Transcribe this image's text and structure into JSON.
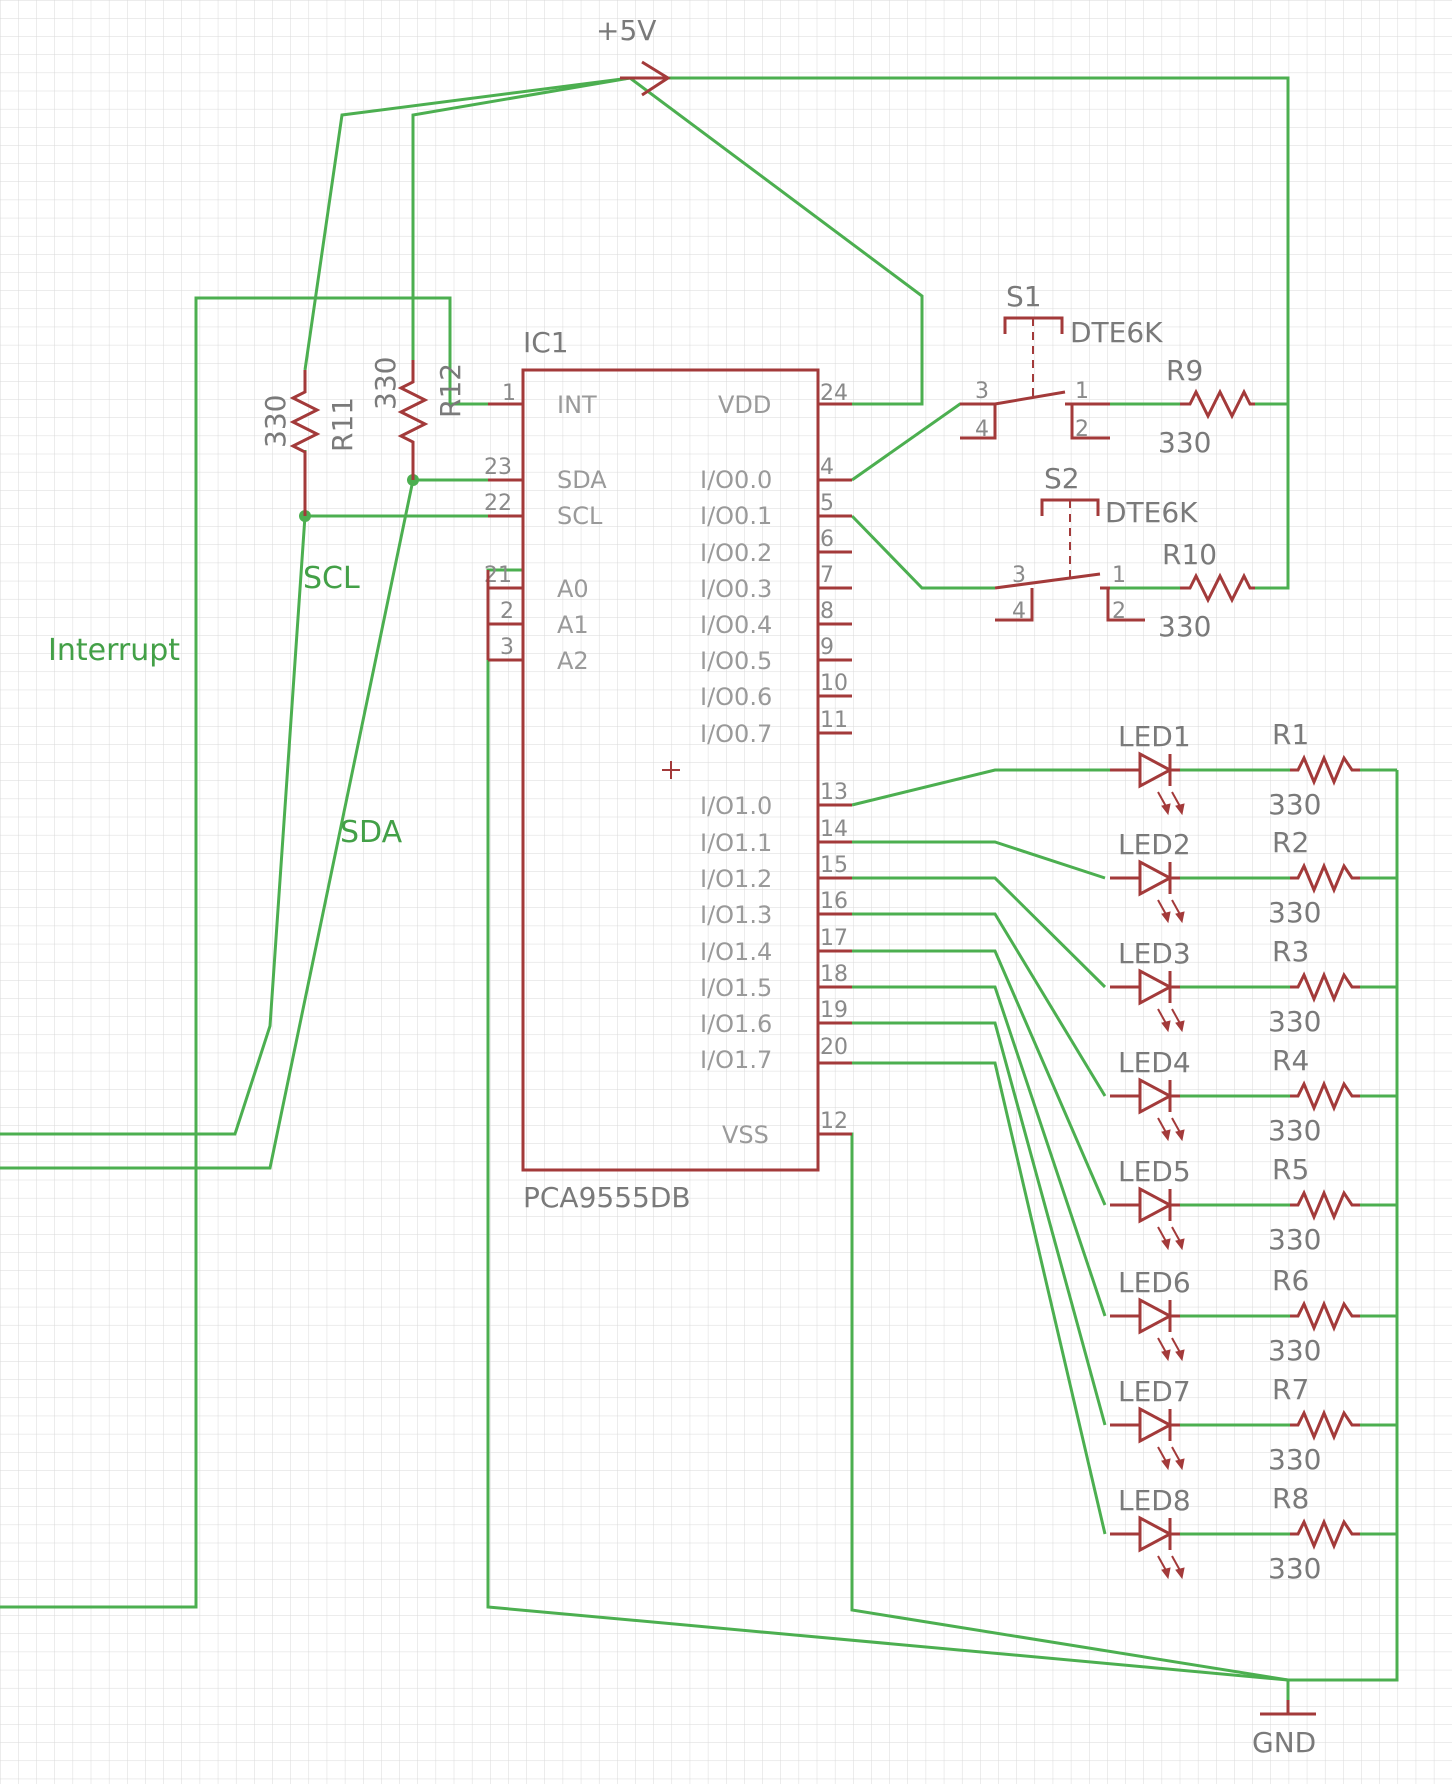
{
  "schematic": {
    "power": {
      "vcc": "+5V",
      "gnd": "GND"
    },
    "ic": {
      "ref": "IC1",
      "value": "PCA9555DB",
      "left_pins": [
        {
          "num": "1",
          "name": "INT"
        },
        {
          "num": "23",
          "name": "SDA"
        },
        {
          "num": "22",
          "name": "SCL"
        },
        {
          "num": "21",
          "name": "A0"
        },
        {
          "num": "2",
          "name": "A1"
        },
        {
          "num": "3",
          "name": "A2"
        }
      ],
      "right_pins": [
        {
          "num": "24",
          "name": "VDD"
        },
        {
          "num": "4",
          "name": "I/O0.0"
        },
        {
          "num": "5",
          "name": "I/O0.1"
        },
        {
          "num": "6",
          "name": "I/O0.2"
        },
        {
          "num": "7",
          "name": "I/O0.3"
        },
        {
          "num": "8",
          "name": "I/O0.4"
        },
        {
          "num": "9",
          "name": "I/O0.5"
        },
        {
          "num": "10",
          "name": "I/O0.6"
        },
        {
          "num": "11",
          "name": "I/O0.7"
        },
        {
          "num": "13",
          "name": "I/O1.0"
        },
        {
          "num": "14",
          "name": "I/O1.1"
        },
        {
          "num": "15",
          "name": "I/O1.2"
        },
        {
          "num": "16",
          "name": "I/O1.3"
        },
        {
          "num": "17",
          "name": "I/O1.4"
        },
        {
          "num": "18",
          "name": "I/O1.5"
        },
        {
          "num": "19",
          "name": "I/O1.6"
        },
        {
          "num": "20",
          "name": "I/O1.7"
        },
        {
          "num": "12",
          "name": "VSS"
        }
      ]
    },
    "pullups": [
      {
        "ref": "R11",
        "value": "330"
      },
      {
        "ref": "R12",
        "value": "330"
      }
    ],
    "net_labels": {
      "scl": "SCL",
      "sda": "SDA",
      "interrupt": "Interrupt"
    },
    "switches": [
      {
        "ref": "S1",
        "value": "DTE6K",
        "pins": [
          "3",
          "1",
          "4",
          "2"
        ],
        "resistor": "R9",
        "res_value": "330"
      },
      {
        "ref": "S2",
        "value": "DTE6K",
        "pins": [
          "3",
          "1",
          "4",
          "2"
        ],
        "resistor": "R10",
        "res_value": "330"
      }
    ],
    "leds": [
      {
        "ref": "LED1",
        "resistor": "R1",
        "res_value": "330"
      },
      {
        "ref": "LED2",
        "resistor": "R2",
        "res_value": "330"
      },
      {
        "ref": "LED3",
        "resistor": "R3",
        "res_value": "330"
      },
      {
        "ref": "LED4",
        "resistor": "R4",
        "res_value": "330"
      },
      {
        "ref": "LED5",
        "resistor": "R5",
        "res_value": "330"
      },
      {
        "ref": "LED6",
        "resistor": "R6",
        "res_value": "330"
      },
      {
        "ref": "LED7",
        "resistor": "R7",
        "res_value": "330"
      },
      {
        "ref": "LED8",
        "resistor": "R8",
        "res_value": "330"
      }
    ],
    "colors": {
      "wire": "#4caf50",
      "part": "#a33a3a",
      "grid": "#d9d9d9",
      "label": "#7a7a7a",
      "net_label": "#43a047"
    }
  }
}
